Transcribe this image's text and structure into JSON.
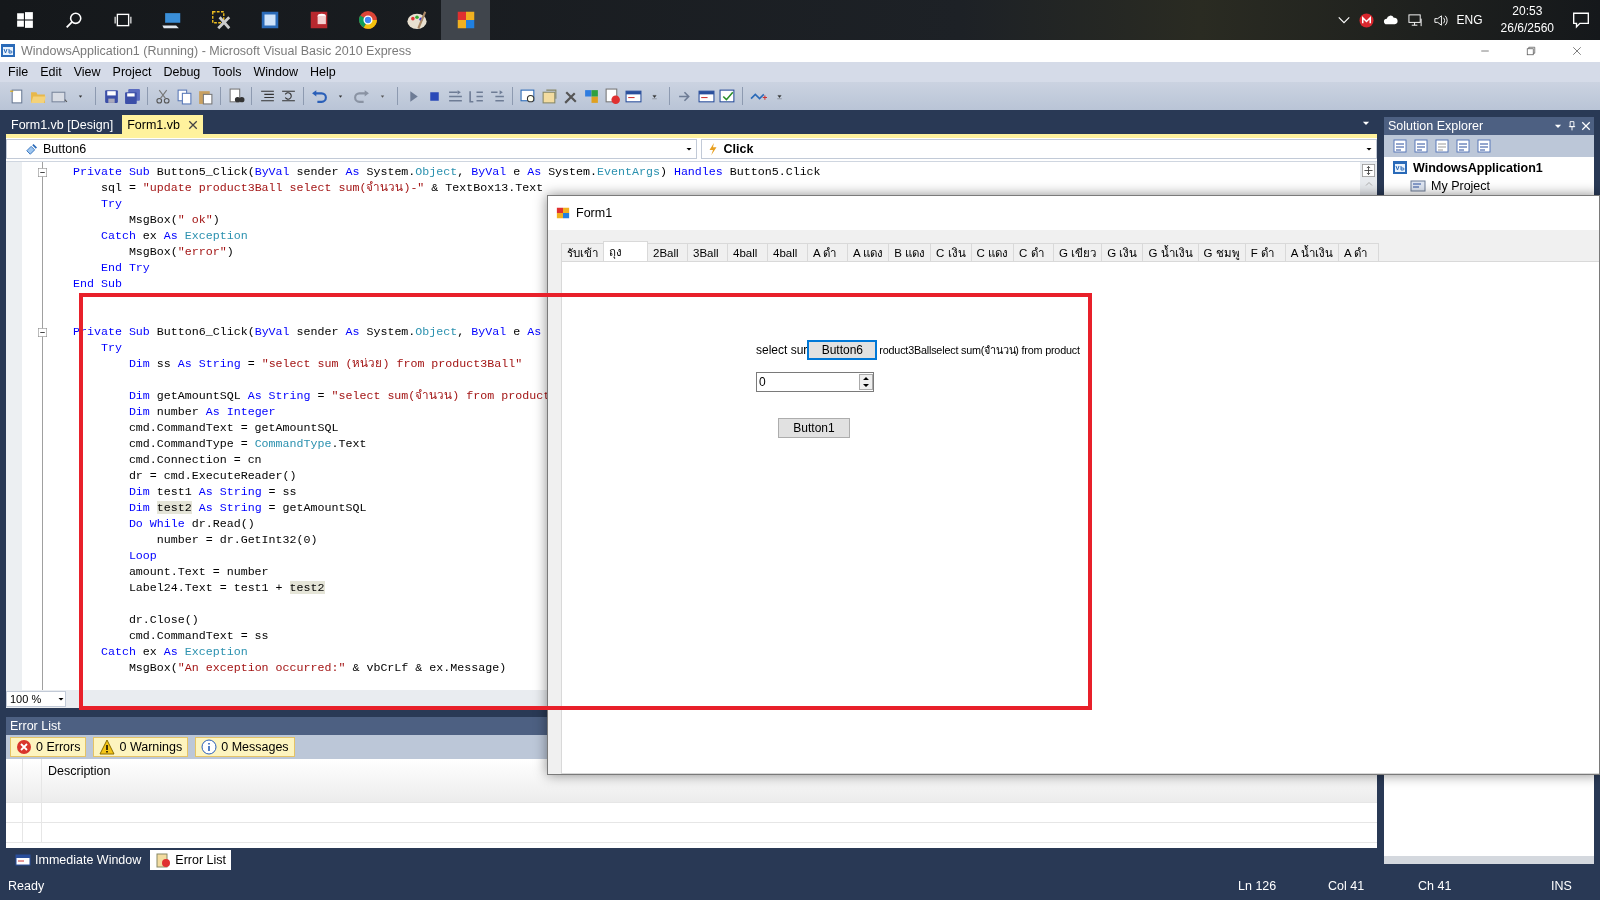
{
  "taskbar": {
    "language": "ENG",
    "time": "20:53",
    "date": "26/6/2560"
  },
  "window": {
    "title": "WindowsApplication1 (Running) - Microsoft Visual Basic 2010 Express"
  },
  "menu": [
    "File",
    "Edit",
    "View",
    "Project",
    "Debug",
    "Tools",
    "Window",
    "Help"
  ],
  "document_tabs": [
    {
      "label": "Form1.vb [Design]",
      "selected": false
    },
    {
      "label": "Form1.vb",
      "selected": true
    }
  ],
  "editor": {
    "object_dropdown": "Button6",
    "event_dropdown": "Click",
    "zoom": "100 %",
    "lines": [
      {
        "kind": "code",
        "fold": true,
        "tokens": [
          {
            "kind": "kw",
            "text": "Private Sub"
          },
          {
            "kind": "plain",
            "text": " Button5_Click("
          },
          {
            "kind": "kw",
            "text": "ByVal"
          },
          {
            "kind": "plain",
            "text": " sender "
          },
          {
            "kind": "kw",
            "text": "As"
          },
          {
            "kind": "plain",
            "text": " System."
          },
          {
            "kind": "type",
            "text": "Object"
          },
          {
            "kind": "plain",
            "text": ", "
          },
          {
            "kind": "kw",
            "text": "ByVal"
          },
          {
            "kind": "plain",
            "text": " e "
          },
          {
            "kind": "kw",
            "text": "As"
          },
          {
            "kind": "plain",
            "text": " System."
          },
          {
            "kind": "type",
            "text": "EventArgs"
          },
          {
            "kind": "plain",
            "text": ") "
          },
          {
            "kind": "kw",
            "text": "Handles"
          },
          {
            "kind": "plain",
            "text": " Button5.Click"
          }
        ]
      },
      {
        "kind": "code",
        "fold": false,
        "tokens": [
          {
            "kind": "plain",
            "text": "    sql = "
          },
          {
            "kind": "str",
            "text": "\"update product3Ball select sum(จำนวน)-\""
          },
          {
            "kind": "plain",
            "text": " & TextBox13.Text"
          }
        ]
      },
      {
        "kind": "code",
        "fold": false,
        "tokens": [
          {
            "kind": "kw",
            "text": "    Try"
          }
        ]
      },
      {
        "kind": "code",
        "fold": false,
        "tokens": [
          {
            "kind": "plain",
            "text": "        MsgBox("
          },
          {
            "kind": "str",
            "text": "\" ok\""
          },
          {
            "kind": "plain",
            "text": ")"
          }
        ]
      },
      {
        "kind": "code",
        "fold": false,
        "tokens": [
          {
            "kind": "kw",
            "text": "    Catch"
          },
          {
            "kind": "plain",
            "text": " ex "
          },
          {
            "kind": "kw",
            "text": "As"
          },
          {
            "kind": "type",
            "text": " Exception"
          }
        ]
      },
      {
        "kind": "code",
        "fold": false,
        "tokens": [
          {
            "kind": "plain",
            "text": "        MsgBox("
          },
          {
            "kind": "str",
            "text": "\"error\""
          },
          {
            "kind": "plain",
            "text": ")"
          }
        ]
      },
      {
        "kind": "code",
        "fold": false,
        "tokens": [
          {
            "kind": "kw",
            "text": "    End Try"
          }
        ]
      },
      {
        "kind": "code",
        "fold": false,
        "tokens": [
          {
            "kind": "kw",
            "text": "End Sub"
          }
        ]
      },
      {
        "kind": "blank"
      },
      {
        "kind": "blank"
      },
      {
        "kind": "code",
        "fold": true,
        "tokens": [
          {
            "kind": "kw",
            "text": "Private Sub"
          },
          {
            "kind": "plain",
            "text": " Button6_Click("
          },
          {
            "kind": "kw",
            "text": "ByVal"
          },
          {
            "kind": "plain",
            "text": " sender "
          },
          {
            "kind": "kw",
            "text": "As"
          },
          {
            "kind": "plain",
            "text": " System."
          },
          {
            "kind": "type",
            "text": "Object"
          },
          {
            "kind": "plain",
            "text": ", "
          },
          {
            "kind": "kw",
            "text": "ByVal"
          },
          {
            "kind": "plain",
            "text": " e "
          },
          {
            "kind": "kw",
            "text": "As"
          }
        ]
      },
      {
        "kind": "code",
        "fold": false,
        "tokens": [
          {
            "kind": "kw",
            "text": "    Try"
          }
        ]
      },
      {
        "kind": "code",
        "fold": false,
        "tokens": [
          {
            "kind": "kw",
            "text": "        Dim"
          },
          {
            "kind": "plain",
            "text": " ss "
          },
          {
            "kind": "kw",
            "text": "As String"
          },
          {
            "kind": "plain",
            "text": " = "
          },
          {
            "kind": "str",
            "text": "\"select sum (หน่วย) from product3Ball\""
          }
        ]
      },
      {
        "kind": "blank"
      },
      {
        "kind": "code",
        "fold": false,
        "tokens": [
          {
            "kind": "kw",
            "text": "        Dim"
          },
          {
            "kind": "plain",
            "text": " getAmountSQL "
          },
          {
            "kind": "kw",
            "text": "As String"
          },
          {
            "kind": "plain",
            "text": " = "
          },
          {
            "kind": "str",
            "text": "\"select sum(จำนวน) from product"
          }
        ]
      },
      {
        "kind": "code",
        "fold": false,
        "tokens": [
          {
            "kind": "kw",
            "text": "        Dim"
          },
          {
            "kind": "plain",
            "text": " number "
          },
          {
            "kind": "kw",
            "text": "As Integer"
          }
        ]
      },
      {
        "kind": "code",
        "fold": false,
        "tokens": [
          {
            "kind": "plain",
            "text": "        cmd.CommandText = getAmountSQL"
          }
        ]
      },
      {
        "kind": "code",
        "fold": false,
        "tokens": [
          {
            "kind": "plain",
            "text": "        cmd.CommandType = "
          },
          {
            "kind": "type",
            "text": "CommandType"
          },
          {
            "kind": "plain",
            "text": ".Text"
          }
        ]
      },
      {
        "kind": "code",
        "fold": false,
        "tokens": [
          {
            "kind": "plain",
            "text": "        cmd.Connection = cn"
          }
        ]
      },
      {
        "kind": "code",
        "fold": false,
        "tokens": [
          {
            "kind": "plain",
            "text": "        dr = cmd.ExecuteReader()"
          }
        ]
      },
      {
        "kind": "code",
        "fold": false,
        "tokens": [
          {
            "kind": "kw",
            "text": "        Dim"
          },
          {
            "kind": "plain",
            "text": " test1 "
          },
          {
            "kind": "kw",
            "text": "As String"
          },
          {
            "kind": "plain",
            "text": " = ss"
          }
        ]
      },
      {
        "kind": "code",
        "fold": false,
        "tokens": [
          {
            "kind": "kw",
            "text": "        Dim "
          },
          {
            "kind": "mark",
            "text": "test2"
          },
          {
            "kind": "kw",
            "text": " As String"
          },
          {
            "kind": "plain",
            "text": " = getAmountSQL"
          }
        ]
      },
      {
        "kind": "code",
        "fold": false,
        "tokens": [
          {
            "kind": "kw",
            "text": "        Do While"
          },
          {
            "kind": "plain",
            "text": " dr.Read()"
          }
        ]
      },
      {
        "kind": "code",
        "fold": false,
        "tokens": [
          {
            "kind": "plain",
            "text": "            number = dr.GetInt32(0)"
          }
        ]
      },
      {
        "kind": "code",
        "fold": false,
        "tokens": [
          {
            "kind": "kw",
            "text": "        Loop"
          }
        ]
      },
      {
        "kind": "code",
        "fold": false,
        "tokens": [
          {
            "kind": "plain",
            "text": "        amount.Text = number"
          }
        ]
      },
      {
        "kind": "code",
        "fold": false,
        "tokens": [
          {
            "kind": "plain",
            "text": "        Label24.Text = test1 + "
          },
          {
            "kind": "mark",
            "text": "test2"
          }
        ]
      },
      {
        "kind": "blank"
      },
      {
        "kind": "code",
        "fold": false,
        "tokens": [
          {
            "kind": "plain",
            "text": "        dr.Close()"
          }
        ]
      },
      {
        "kind": "code",
        "fold": false,
        "tokens": [
          {
            "kind": "plain",
            "text": "        cmd.CommandText = ss"
          }
        ]
      },
      {
        "kind": "code",
        "fold": false,
        "tokens": [
          {
            "kind": "kw",
            "text": "    Catch"
          },
          {
            "kind": "plain",
            "text": " ex "
          },
          {
            "kind": "kw",
            "text": "As"
          },
          {
            "kind": "type",
            "text": " Exception"
          }
        ]
      },
      {
        "kind": "code",
        "fold": false,
        "tokens": [
          {
            "kind": "plain",
            "text": "        MsgBox("
          },
          {
            "kind": "str",
            "text": "\"An exception occurred:\""
          },
          {
            "kind": "plain",
            "text": " & vbCrLf & ex.Message)"
          }
        ]
      }
    ]
  },
  "solution_explorer": {
    "title": "Solution Explorer",
    "tree": [
      {
        "label": "WindowsApplication1",
        "children": [
          {
            "label": "My Project"
          }
        ]
      }
    ]
  },
  "error_list": {
    "title": "Error List",
    "filters": [
      {
        "kind": "error",
        "label": "0 Errors",
        "selected": true
      },
      {
        "kind": "warning",
        "label": "0 Warnings",
        "selected": true
      },
      {
        "kind": "message",
        "label": "0 Messages",
        "selected": true
      }
    ],
    "columns": [
      "Description"
    ]
  },
  "bottom_tabs": [
    {
      "kind": "immediate",
      "label": "Immediate Window",
      "selected": false
    },
    {
      "kind": "errors",
      "label": "Error List",
      "selected": true
    }
  ],
  "status_bar": {
    "state": "Ready",
    "line": "Ln 126",
    "column": "Col 41",
    "character": "Ch 41",
    "mode": "INS"
  },
  "form_window": {
    "title": "Form1",
    "tabs": [
      {
        "label": "รับเข้า",
        "selected": false
      },
      {
        "label": "ถุง",
        "selected": true
      },
      {
        "label": "2Ball",
        "selected": false
      },
      {
        "label": "3Ball",
        "selected": false
      },
      {
        "label": "4ball",
        "selected": false
      },
      {
        "label": "4ball",
        "selected": false
      },
      {
        "label": "A ดำ",
        "selected": false
      },
      {
        "label": "A แดง",
        "selected": false
      },
      {
        "label": "B แดง",
        "selected": false
      },
      {
        "label": "C เงิน",
        "selected": false
      },
      {
        "label": "C แดง",
        "selected": false
      },
      {
        "label": "C ดำ",
        "selected": false
      },
      {
        "label": "G เขียว",
        "selected": false
      },
      {
        "label": "G เงิน",
        "selected": false
      },
      {
        "label": "G น้ำเงิน",
        "selected": false
      },
      {
        "label": "G ชมพู",
        "selected": false
      },
      {
        "label": "F ดำ",
        "selected": false
      },
      {
        "label": "A น้ำเงิน",
        "selected": false
      },
      {
        "label": "A ดำ",
        "selected": false
      }
    ],
    "label_start": "select sur",
    "button": {
      "label": "Button6",
      "focused": true
    },
    "label_end": "roduct3Ballselect sum(จำนวน) from product",
    "number_value": "0",
    "button_2": "Button1"
  }
}
